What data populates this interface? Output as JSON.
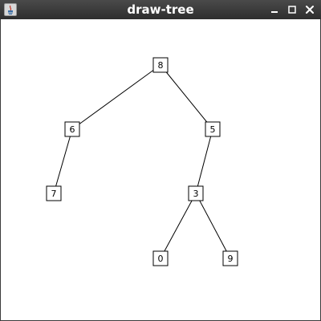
{
  "window": {
    "title": "draw-tree",
    "app_icon": "java-icon",
    "controls": {
      "minimize_icon": "minimize-icon",
      "maximize_icon": "maximize-icon",
      "close_icon": "close-icon"
    }
  },
  "tree": {
    "root": "8",
    "nodes": [
      "8",
      "6",
      "5",
      "7",
      "3",
      "0",
      "9"
    ],
    "edges": [
      [
        "8",
        "6"
      ],
      [
        "8",
        "5"
      ],
      [
        "6",
        "7"
      ],
      [
        "5",
        "3"
      ],
      [
        "3",
        "0"
      ],
      [
        "3",
        "9"
      ]
    ]
  },
  "colors": {
    "titlebar": "#3a3a3a",
    "canvas": "#ffffff",
    "node_border": "#000000",
    "edge": "#000000"
  }
}
